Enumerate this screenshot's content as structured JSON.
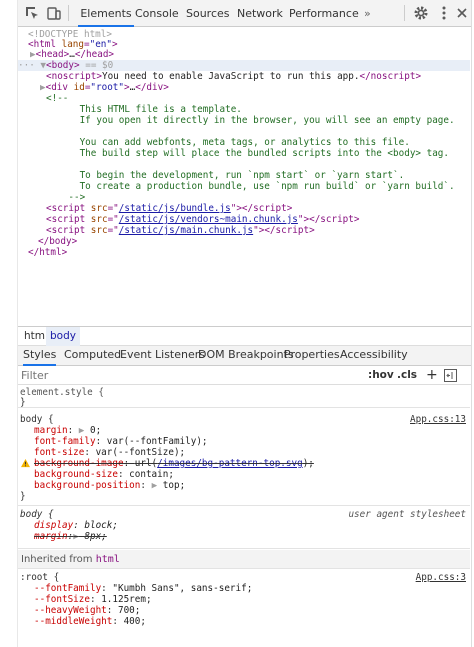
{
  "toolbar": {
    "tabs": [
      "Elements",
      "Console",
      "Sources",
      "Network",
      "Performance"
    ],
    "more": "»"
  },
  "dom": {
    "doctype": "<!DOCTYPE html>",
    "html_open_tag": "html",
    "html_attr": "lang",
    "html_attr_val": "\"en\"",
    "head": "head",
    "head_ellipsis": "…",
    "body_tag": "body",
    "body_marker": "== $0",
    "noscript_text": "You need to enable JavaScript to run this app.",
    "div_attr": "id",
    "div_val": "\"root\"",
    "comment_lines": [
      "<!--",
      "      This HTML file is a template.",
      "      If you open it directly in the browser, you will see an empty page.",
      "",
      "      You can add webfonts, meta tags, or analytics to this file.",
      "      The build step will place the bundled scripts into the <body> tag.",
      "",
      "      To begin the development, run `npm start` or `yarn start`.",
      "      To create a production bundle, use `npm run build` or `yarn build`.",
      "    -->"
    ],
    "scripts": [
      "/static/js/bundle.js",
      "/static/js/vendors~main.chunk.js",
      "/static/js/main.chunk.js"
    ]
  },
  "breadcrumbs": [
    "html",
    "body"
  ],
  "subtabs": [
    "Styles",
    "Computed",
    "Event Listeners",
    "DOM Breakpoints",
    "Properties",
    "Accessibility"
  ],
  "filter": {
    "placeholder": "Filter",
    "hov": ":hov",
    "cls": ".cls",
    "plus": "+"
  },
  "styles": {
    "element_style": "element.style {",
    "close": "}",
    "body_rule": {
      "selector": "body {",
      "source": "App.css:13",
      "margin": "0;",
      "font_family": "var(--fontFamily);",
      "font_size": "var(--fontSize);",
      "bg_image_prefix": "url(",
      "bg_image_link": "/images/bg-pattern-top.svg",
      "bg_image_suffix": ");",
      "bg_size": "contain;",
      "bg_position": "top;"
    },
    "ua_rule": {
      "selector": "body {",
      "source": "user agent stylesheet",
      "display": "block;",
      "margin": "8px;"
    },
    "inherited_label": "Inherited from",
    "inherited_tag": "html",
    "root_rule": {
      "selector": ":root {",
      "source": "App.css:3",
      "font_family": "\"Kumbh Sans\", sans-serif;",
      "font_size": "1.125rem;",
      "heavy": "700;",
      "middle": "400;"
    }
  }
}
